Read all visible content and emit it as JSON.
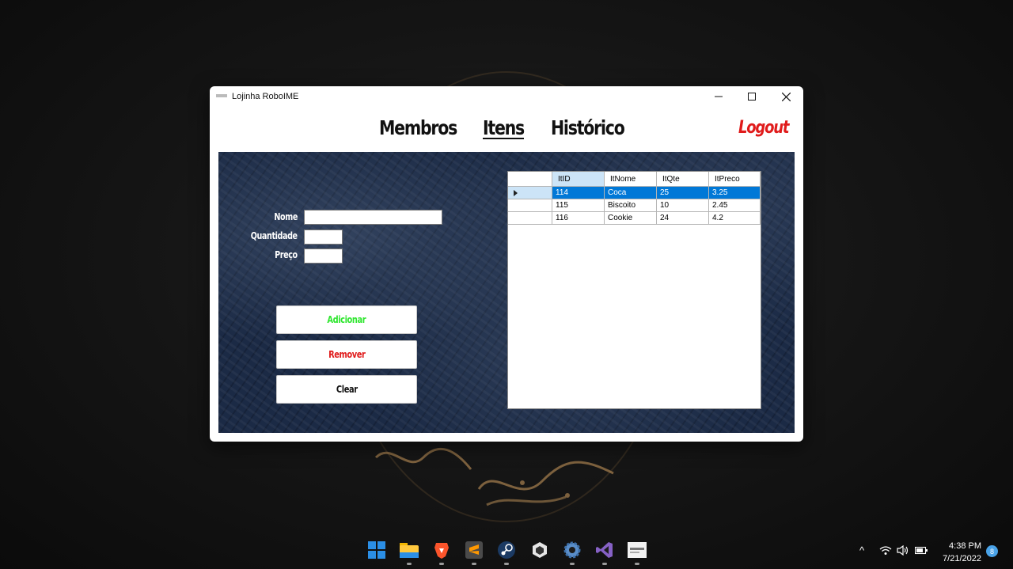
{
  "window": {
    "title": "Lojinha RoboIME"
  },
  "nav": {
    "membros": "Membros",
    "itens": "Itens",
    "historico": "Histórico",
    "logout": "Logout"
  },
  "form": {
    "nome_label": "Nome",
    "quantidade_label": "Quantidade",
    "preco_label": "Preço",
    "nome_value": "",
    "quantidade_value": "",
    "preco_value": ""
  },
  "buttons": {
    "adicionar": "Adicionar",
    "remover": "Remover",
    "clear": "Clear"
  },
  "grid": {
    "columns": [
      "ItID",
      "ItNome",
      "ItQte",
      "ItPreco"
    ],
    "rows": [
      [
        "114",
        "Coca",
        "25",
        "3.25"
      ],
      [
        "115",
        "Biscoito",
        "10",
        "2.45"
      ],
      [
        "116",
        "Cookie",
        "24",
        "4.2"
      ]
    ]
  },
  "taskbar": {
    "time": "4:38 PM",
    "date": "7/21/2022",
    "notifications": "8",
    "apps": [
      "start-icon",
      "file-explorer-icon",
      "brave-browser-icon",
      "sublime-text-icon",
      "steam-icon",
      "unity-hub-icon",
      "settings-icon",
      "visual-studio-icon",
      "app-thumbnail-icon"
    ]
  },
  "colors": {
    "accent_blue": "#0078d7",
    "add_green": "#2ee62e",
    "remove_red": "#e01b1b",
    "panel_navy": "#1b2a45"
  }
}
